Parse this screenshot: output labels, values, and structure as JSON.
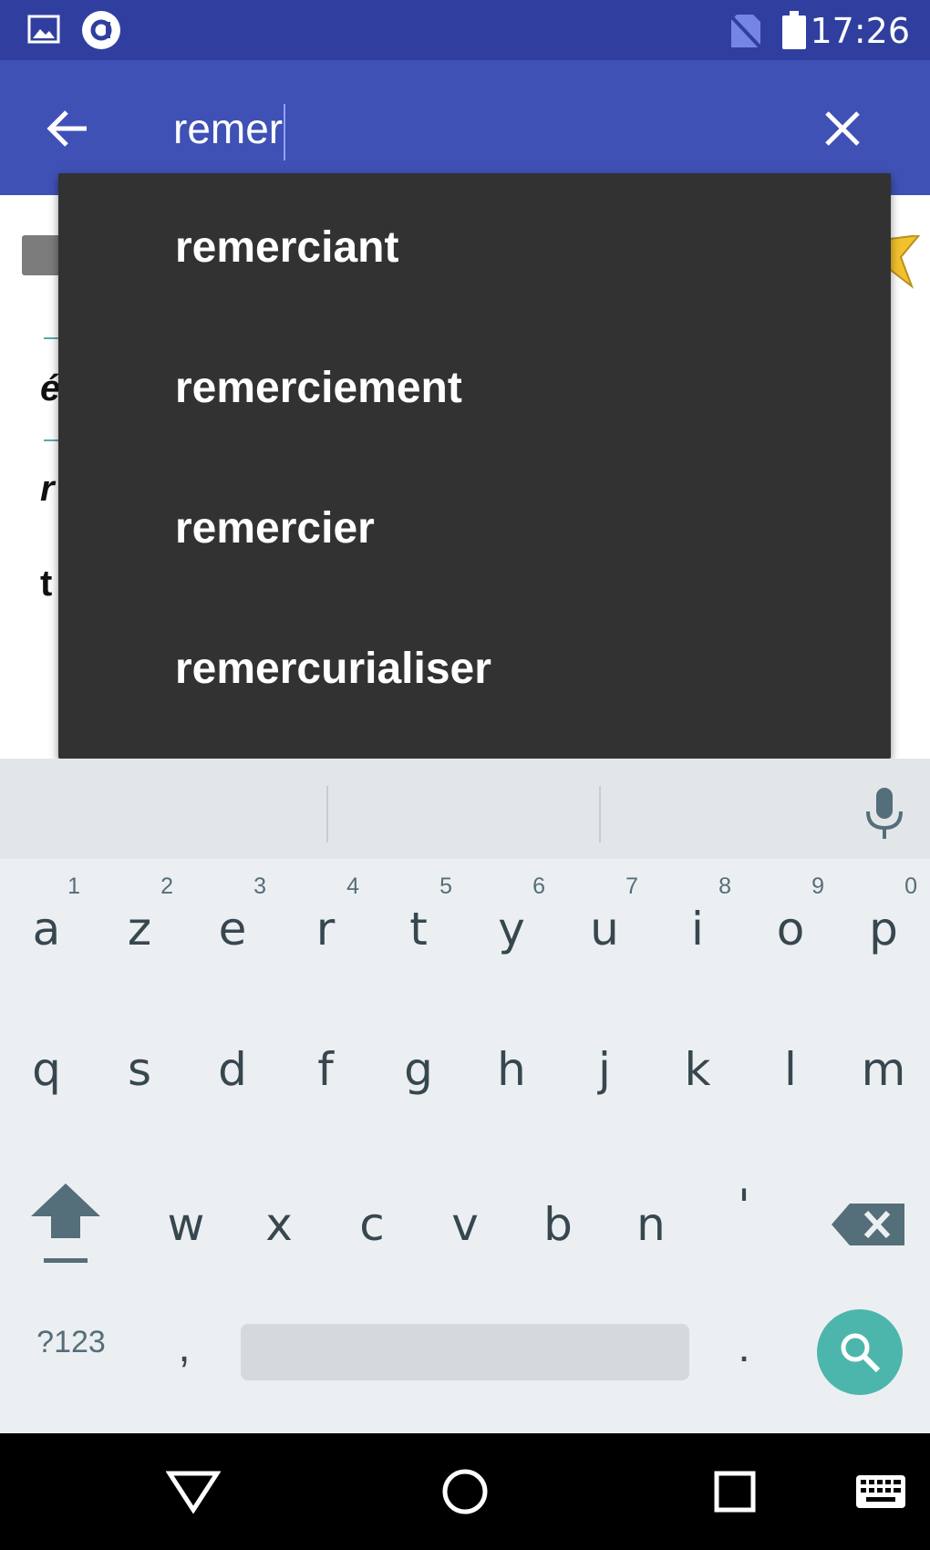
{
  "status_bar": {
    "time": "17:26",
    "icons": [
      "image-icon",
      "app-notification-icon",
      "no-sim-icon",
      "battery-icon"
    ]
  },
  "app_bar": {
    "search_value": "remer",
    "back_icon": "arrow-left-icon",
    "clear_icon": "close-icon"
  },
  "suggestions": [
    "remerciant",
    "remerciement",
    "remercier",
    "remercurialiser"
  ],
  "page_peek": {
    "chars": [
      "é",
      "r",
      "t"
    ]
  },
  "keyboard": {
    "row1": [
      {
        "label": "a",
        "hint": "1"
      },
      {
        "label": "z",
        "hint": "2"
      },
      {
        "label": "e",
        "hint": "3"
      },
      {
        "label": "r",
        "hint": "4"
      },
      {
        "label": "t",
        "hint": "5"
      },
      {
        "label": "y",
        "hint": "6"
      },
      {
        "label": "u",
        "hint": "7"
      },
      {
        "label": "i",
        "hint": "8"
      },
      {
        "label": "o",
        "hint": "9"
      },
      {
        "label": "p",
        "hint": "0"
      }
    ],
    "row2": [
      "q",
      "s",
      "d",
      "f",
      "g",
      "h",
      "j",
      "k",
      "l",
      "m"
    ],
    "row3": [
      "w",
      "x",
      "c",
      "v",
      "b",
      "n",
      "'"
    ],
    "symbols_label": "?123",
    "comma_label": ",",
    "period_label": ".",
    "accent_color": "#4db6ac"
  },
  "nav_bar": {
    "icons": [
      "back-triangle-icon",
      "home-circle-icon",
      "recents-square-icon",
      "keyboard-switch-icon"
    ]
  }
}
